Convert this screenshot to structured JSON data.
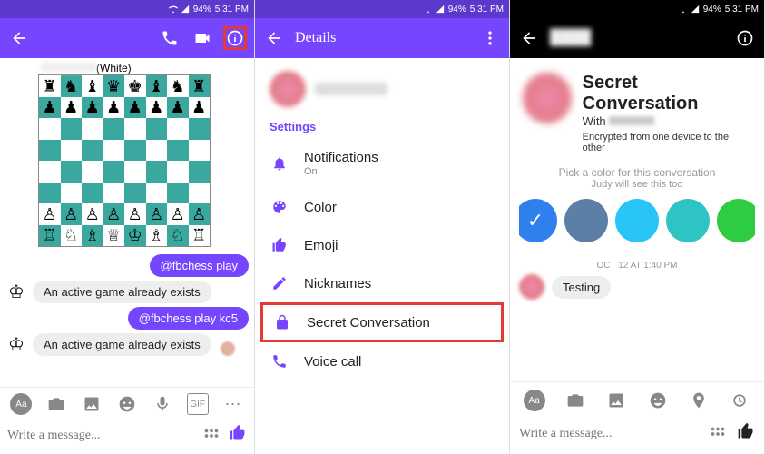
{
  "status": {
    "battery": "94%",
    "time": "5:31 PM"
  },
  "panel1": {
    "contact_name": "",
    "chess_side": "(White)",
    "messages": [
      {
        "dir": "out",
        "text": "@fbchess play"
      },
      {
        "dir": "in",
        "text": "An active game already exists"
      },
      {
        "dir": "out",
        "text": "@fbchess play kc5"
      },
      {
        "dir": "in",
        "text": "An active game already exists"
      }
    ],
    "compose_placeholder": "Write a message..."
  },
  "panel2": {
    "title": "Details",
    "section": "Settings",
    "rows": [
      {
        "icon": "bell",
        "label": "Notifications",
        "sub": "On"
      },
      {
        "icon": "palette",
        "label": "Color"
      },
      {
        "icon": "thumb",
        "label": "Emoji"
      },
      {
        "icon": "pencil",
        "label": "Nicknames"
      },
      {
        "icon": "lock",
        "label": "Secret Conversation",
        "boxed": true
      },
      {
        "icon": "phone",
        "label": "Voice call"
      }
    ]
  },
  "panel3": {
    "title": "Secret Conversation",
    "with_prefix": "With",
    "encrypted": "Encrypted from one device to the other",
    "color_hint": "Pick a color for this conversation",
    "color_hint2": "Judy will see this too",
    "swatches": [
      "#2f80ed",
      "#5b7fa6",
      "#29c5f6",
      "#2ec4c4",
      "#2ecc40"
    ],
    "selected_swatch": 0,
    "timestamp": "OCT 12 AT 1:40 PM",
    "incoming": "Testing",
    "compose_placeholder": "Write a message..."
  }
}
